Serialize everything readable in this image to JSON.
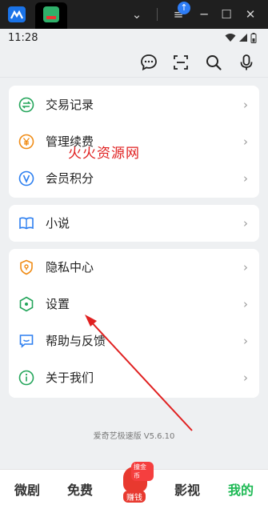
{
  "window": {
    "minimize_glyph": "─",
    "restore_glyph": "☐",
    "close_glyph": "✕",
    "menu_glyph": "≡",
    "dropdown_glyph": "⌄",
    "update_glyph": "↑"
  },
  "status": {
    "time": "11:28"
  },
  "toolbar_icons": [
    "message-icon",
    "scan-icon",
    "search-icon",
    "microphone-icon"
  ],
  "sections": [
    {
      "items": [
        {
          "label": "交易记录",
          "icon": "exchange-icon",
          "color": "#23a55a"
        },
        {
          "label": "管理续费",
          "icon": "yen-icon",
          "color": "#f08c16"
        },
        {
          "label": "会员积分",
          "icon": "points-icon",
          "color": "#2d7ff0"
        }
      ]
    },
    {
      "items": [
        {
          "label": "小说",
          "icon": "book-icon",
          "color": "#2d7ff0"
        }
      ]
    },
    {
      "items": [
        {
          "label": "隐私中心",
          "icon": "shield-icon",
          "color": "#f08c16"
        },
        {
          "label": "设置",
          "icon": "settings-icon",
          "color": "#23a55a"
        },
        {
          "label": "帮助与反馈",
          "icon": "feedback-icon",
          "color": "#2d7ff0"
        },
        {
          "label": "关于我们",
          "icon": "info-icon",
          "color": "#23a55a"
        }
      ]
    }
  ],
  "chevron": "›",
  "watermark": "火火资源网",
  "version": "爱奇艺极速版 V5.6.10",
  "bottom_nav": {
    "items": [
      {
        "label": "微剧"
      },
      {
        "label": "免费"
      },
      {
        "label": "影视"
      },
      {
        "label": "我的"
      }
    ],
    "earn": {
      "tag": "撞金币",
      "label": "赚钱"
    },
    "active_color": "#1db954"
  }
}
